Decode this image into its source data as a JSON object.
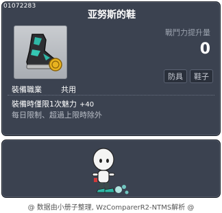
{
  "item": {
    "id": "01072283",
    "name": "亚努斯的鞋",
    "icon_name": "shoe-icon",
    "stat_label": "戰鬥力提升量",
    "stat_value": "0",
    "tags": [
      "防具",
      "鞋子"
    ],
    "job_label": "裝備職業",
    "job_value": "共用",
    "effect_label": "裝備時僅限1次魅力",
    "effect_value": "+40",
    "limit_text": "每日限制、超過上限時除外"
  },
  "preview": {
    "icon_name": "character-preview-icon"
  },
  "footer": {
    "credit": "@ 数据由小册子整理, WzComparerR2-NTMS解析 @"
  },
  "colors": {
    "panel": "#3b4250",
    "border": "#1c2028",
    "muted_text": "#9aa1ad"
  }
}
